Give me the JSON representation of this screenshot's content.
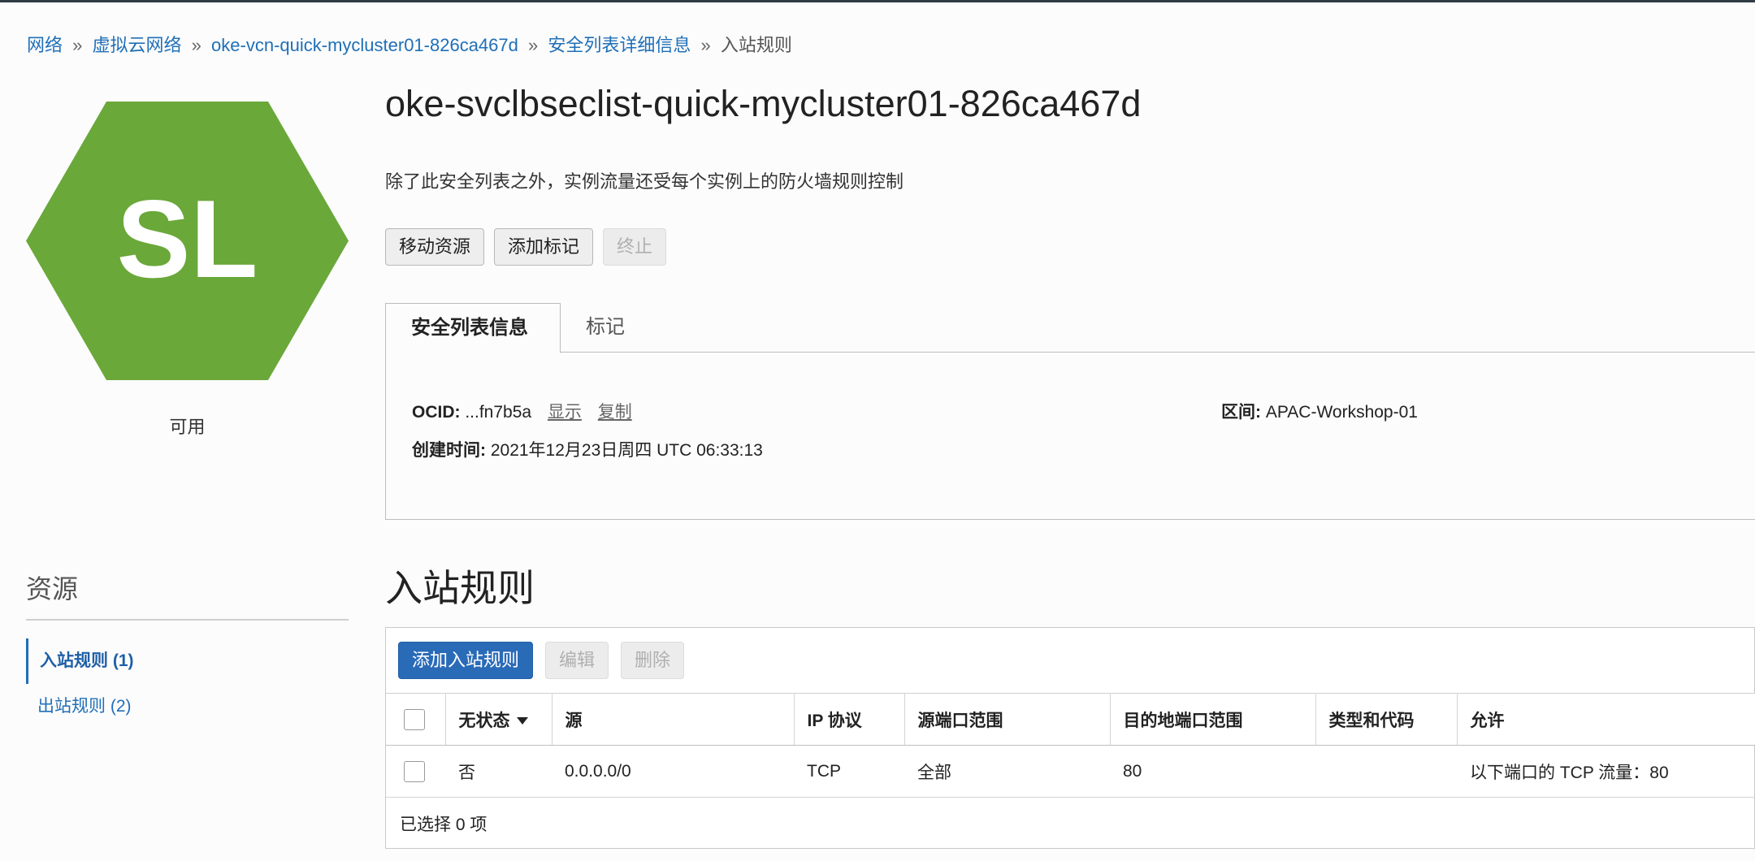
{
  "breadcrumb": {
    "items": [
      "网络",
      "虚拟云网络",
      "oke-vcn-quick-mycluster01-826ca467d",
      "安全列表详细信息"
    ],
    "current": "入站规则",
    "separator": "»"
  },
  "resource": {
    "icon_letters": "SL",
    "icon_color": "#6aa83a",
    "status": "可用",
    "title": "oke-svclbseclist-quick-mycluster01-826ca467d",
    "description": "除了此安全列表之外，实例流量还受每个实例上的防火墙规则控制"
  },
  "actions": {
    "move": "移动资源",
    "add_tag": "添加标记",
    "terminate": "终止"
  },
  "tabs": {
    "info": "安全列表信息",
    "tags": "标记"
  },
  "info": {
    "ocid_label": "OCID:",
    "ocid_value": "...fn7b5a",
    "show_link": "显示",
    "copy_link": "复制",
    "compartment_label": "区间:",
    "compartment_value": "APAC-Workshop-01",
    "created_label": "创建时间:",
    "created_value": "2021年12月23日周四 UTC 06:33:13"
  },
  "resources_nav": {
    "title": "资源",
    "items": [
      "入站规则 (1)",
      "出站规则 (2)"
    ]
  },
  "inbound": {
    "title": "入站规则",
    "add_button": "添加入站规则",
    "edit_button": "编辑",
    "delete_button": "删除",
    "columns": [
      "无状态",
      "源",
      "IP 协议",
      "源端口范围",
      "目的地端口范围",
      "类型和代码",
      "允许"
    ],
    "rows": [
      {
        "stateless": "否",
        "source": "0.0.0.0/0",
        "protocol": "TCP",
        "source_ports": "全部",
        "dest_ports": "80",
        "type_code": "",
        "allows": "以下端口的 TCP 流量：80"
      }
    ],
    "selected_text": "已选择 0 项"
  }
}
